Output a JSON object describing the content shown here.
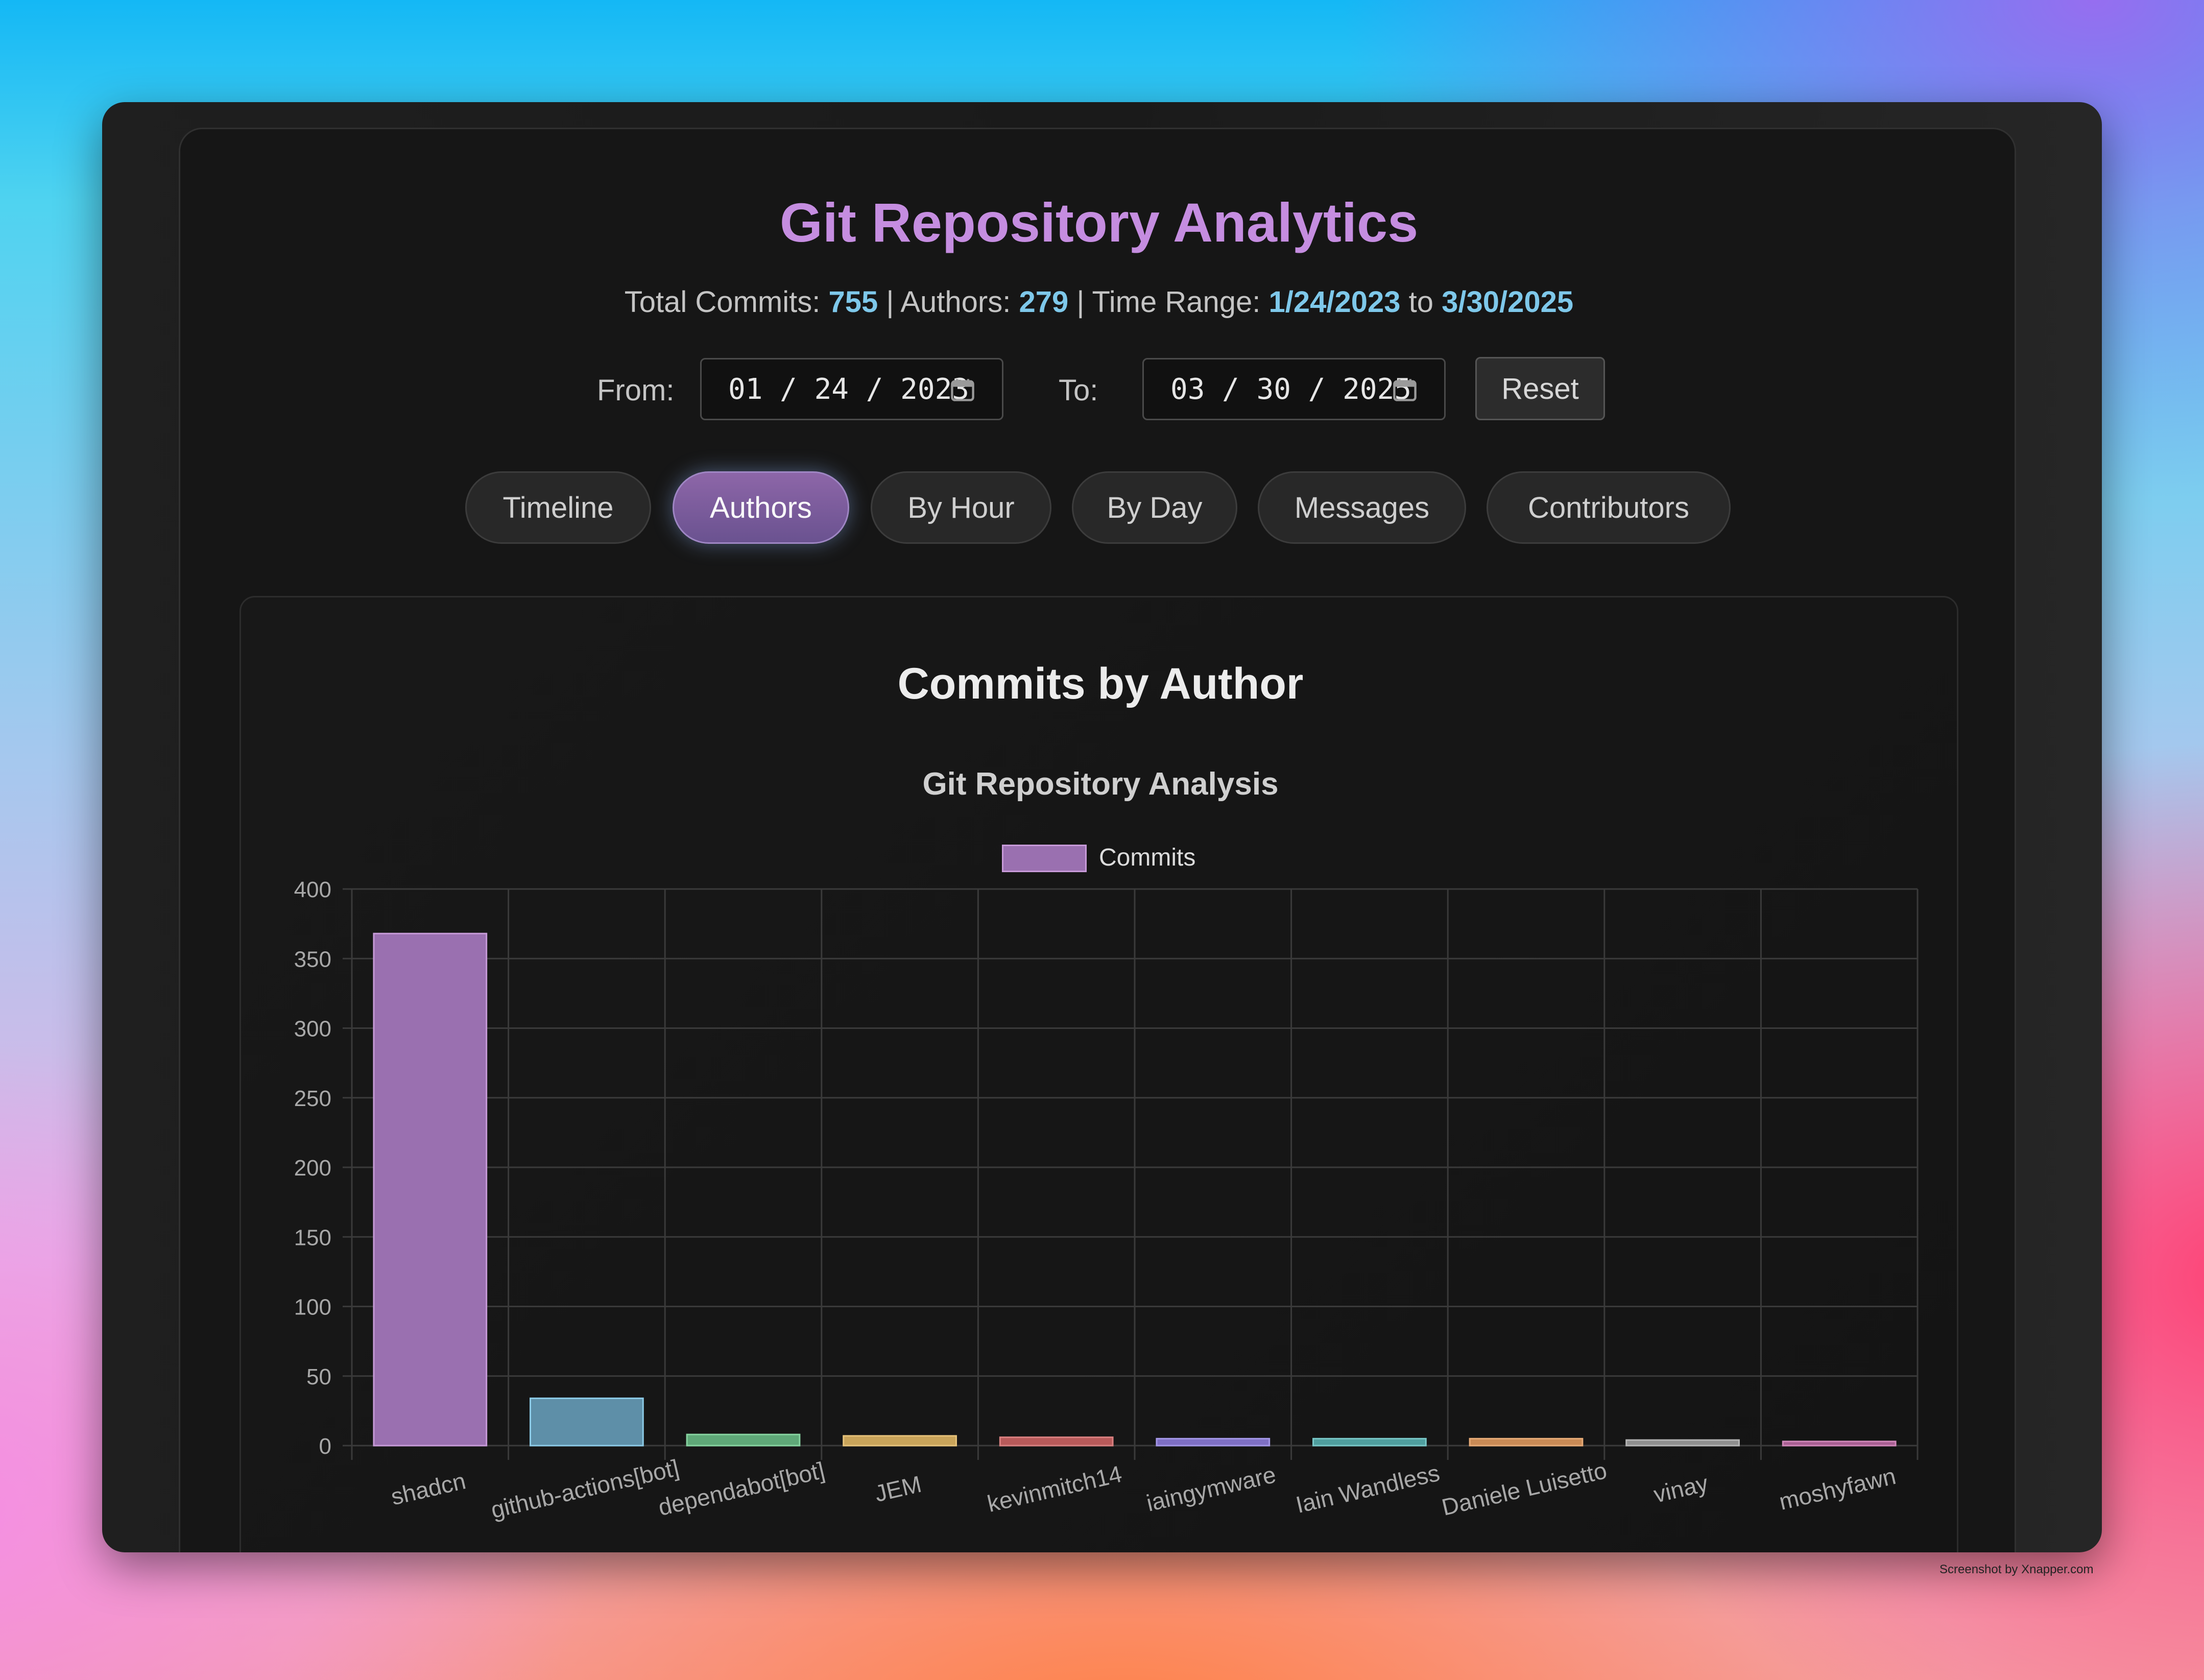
{
  "header": {
    "title": "Git Repository Analytics",
    "stats": {
      "commits_label": "Total Commits:",
      "commits_value": "755",
      "authors_label": "| Authors:",
      "authors_value": "279",
      "range_label": "| Time Range:",
      "range_start": "1/24/2023",
      "range_to": "to",
      "range_end": "3/30/2025"
    }
  },
  "filters": {
    "from_label": "From:",
    "from_value": "01 / 24 / 2023",
    "to_label": "To:",
    "to_value": "03 / 30 / 2025",
    "reset_label": "Reset"
  },
  "tabs": [
    {
      "label": "Timeline",
      "active": false
    },
    {
      "label": "Authors",
      "active": true
    },
    {
      "label": "By Hour",
      "active": false
    },
    {
      "label": "By Day",
      "active": false
    },
    {
      "label": "Messages",
      "active": false
    },
    {
      "label": "Contributors",
      "active": false
    }
  ],
  "icons": {
    "date_picker": "calendar-icon"
  },
  "colors": {
    "accent_title": "#c58de0",
    "stat_value": "#7ec8ea",
    "active_tab": "#7a5c9c"
  },
  "card": {
    "title": "Commits by Author"
  },
  "chart_data": {
    "type": "bar",
    "title": "Git Repository Analysis",
    "xlabel": "",
    "ylabel": "",
    "legend": "top-center",
    "grid": true,
    "ylim": [
      0,
      400
    ],
    "yticks": [
      0,
      50,
      100,
      150,
      200,
      250,
      300,
      350,
      400
    ],
    "categories": [
      "shadcn",
      "github-actions[bot]",
      "dependabot[bot]",
      "JEM",
      "kevinmitch14",
      "iaingymware",
      "Iain Wandless",
      "Daniele Luisetto",
      "vinay",
      "moshyfawn"
    ],
    "series": [
      {
        "name": "Commits",
        "values": [
          368,
          34,
          8,
          7,
          6,
          5,
          5,
          5,
          4,
          3
        ]
      }
    ],
    "bar_colors": [
      "#9a70b0",
      "#5e8fa8",
      "#5fa878",
      "#c9a45a",
      "#b85a5a",
      "#7e6fc4",
      "#4f9e9e",
      "#c98a55",
      "#8f8f8f",
      "#a85e92"
    ],
    "bar_border_colors": [
      "#c79ad8",
      "#8ccae6",
      "#86d29f",
      "#e6c27a",
      "#d98080",
      "#a396e6",
      "#78c6c6",
      "#e6aa76",
      "#b4b4b4",
      "#cf86b8"
    ]
  },
  "watermark": "Screenshot by Xnapper.com"
}
